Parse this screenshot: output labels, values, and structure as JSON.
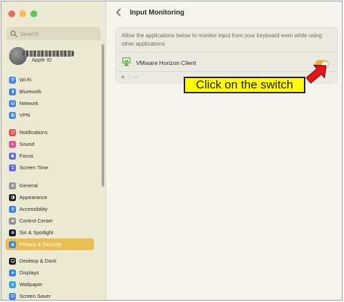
{
  "sidebar": {
    "search_placeholder": "Search",
    "account": {
      "label": "Apple ID"
    },
    "groups": [
      [
        {
          "label": "Wi-Fi",
          "icon": "wifi-icon",
          "color": "#3b82f6"
        },
        {
          "label": "Bluetooth",
          "icon": "bluetooth-icon",
          "color": "#3b82f6"
        },
        {
          "label": "Network",
          "icon": "network-icon",
          "color": "#3b82f6"
        },
        {
          "label": "VPN",
          "icon": "vpn-icon",
          "color": "#3b82f6"
        }
      ],
      [
        {
          "label": "Notifications",
          "icon": "notifications-icon",
          "color": "#ef4444"
        },
        {
          "label": "Sound",
          "icon": "sound-icon",
          "color": "#ec4899"
        },
        {
          "label": "Focus",
          "icon": "focus-icon",
          "color": "#6366f1"
        },
        {
          "label": "Screen Time",
          "icon": "screen-time-icon",
          "color": "#6366f1"
        }
      ],
      [
        {
          "label": "General",
          "icon": "gear-icon",
          "color": "#8e8e93"
        },
        {
          "label": "Appearance",
          "icon": "appearance-icon",
          "color": "#1c1c1e"
        },
        {
          "label": "Accessibility",
          "icon": "accessibility-icon",
          "color": "#3b82f6"
        },
        {
          "label": "Control Center",
          "icon": "control-center-icon",
          "color": "#8e8e93"
        },
        {
          "label": "Siri & Spotlight",
          "icon": "siri-icon",
          "color": "#1c1c1e"
        },
        {
          "label": "Privacy & Security",
          "icon": "hand-icon",
          "color": "#3b82f6",
          "selected": true
        }
      ],
      [
        {
          "label": "Desktop & Dock",
          "icon": "desktop-dock-icon",
          "color": "#1c1c1e"
        },
        {
          "label": "Displays",
          "icon": "displays-icon",
          "color": "#3b82f6"
        },
        {
          "label": "Wallpaper",
          "icon": "wallpaper-icon",
          "color": "#22a7f0"
        },
        {
          "label": "Screen Saver",
          "icon": "screen-saver-icon",
          "color": "#3b82f6"
        }
      ]
    ]
  },
  "main": {
    "title": "Input Monitoring",
    "description": "Allow the applications below to monitor input from your keyboard even while using other applications.",
    "apps": [
      {
        "name": "VMware Horizon Client",
        "enabled": true
      }
    ],
    "add_label": "+",
    "remove_label": "−"
  },
  "annotation": {
    "text": "Click on the switch"
  },
  "colors": {
    "accent": "#e6b638",
    "sidebar_bg": "#ecead3",
    "selected_bg": "#e8be55",
    "callout_bg": "#fffb00",
    "arrow": "#e8141c"
  }
}
